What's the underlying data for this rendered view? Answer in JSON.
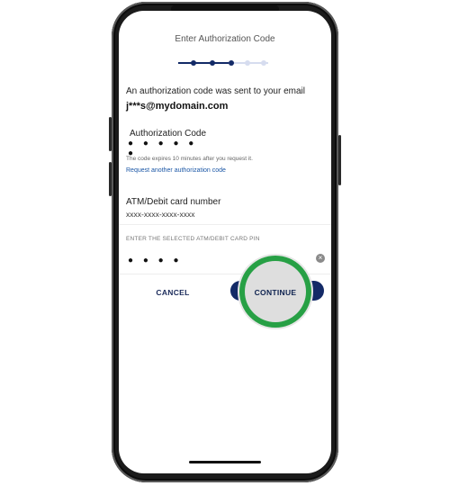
{
  "screen": {
    "title": "Enter Authorization Code",
    "progress": {
      "total_steps": 5,
      "current_step": 3
    },
    "message": "An authorization code was sent to your email",
    "email": "j***s@mydomain.com",
    "auth_code": {
      "label": "Authorization Code",
      "value_masked": "● ● ● ● ● ●",
      "note": "The code expires 10 minutes after you request it.",
      "link": "Request another authorization code"
    },
    "card": {
      "label": "ATM/Debit card number",
      "value": "xxxx-xxxx-xxxx-xxxx"
    },
    "pin": {
      "placeholder": "ENTER THE SELECTED ATM/DEBIT CARD PIN",
      "value_masked": "● ● ● ●"
    },
    "buttons": {
      "cancel": "CANCEL",
      "continue": "CONTINUE"
    }
  },
  "colors": {
    "accent": "#132a67",
    "link": "#1b57a6",
    "highlight_ring": "#27a045",
    "progress_inactive": "#d6dcef"
  }
}
